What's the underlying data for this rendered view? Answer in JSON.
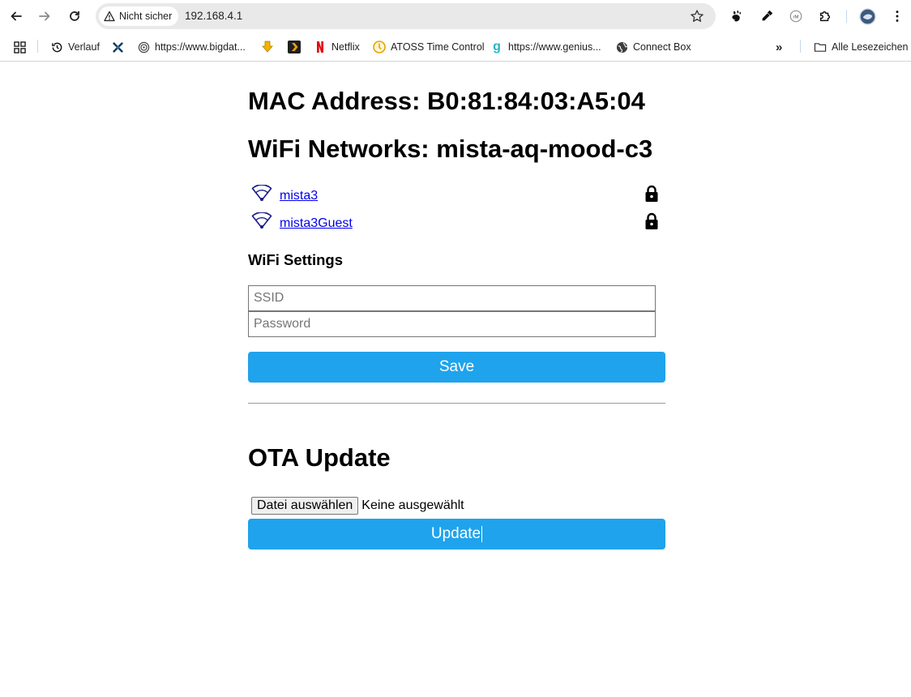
{
  "browser": {
    "security_label": "Nicht sicher",
    "url": "192.168.4.1",
    "bookmarks": [
      {
        "label": "",
        "icon": "apps-grid-icon"
      },
      {
        "label": "Verlauf",
        "icon": "history-icon"
      },
      {
        "label": "",
        "icon": "x-logo-icon"
      },
      {
        "label": "https://www.bigdat...",
        "icon": "globe-circle-icon"
      },
      {
        "label": "",
        "icon": "download-arrow-icon"
      },
      {
        "label": "",
        "icon": "plex-icon"
      },
      {
        "label": "Netflix",
        "icon": "netflix-icon"
      },
      {
        "label": "ATOSS Time Control",
        "icon": "atoss-icon"
      },
      {
        "label": "https://www.genius...",
        "icon": "genius-icon"
      },
      {
        "label": "Connect Box",
        "icon": "globe-icon"
      }
    ],
    "overflow": "»",
    "all_bookmarks_label": "Alle Lesezeichen"
  },
  "page": {
    "mac_heading": "MAC Address: B0:81:84:03:A5:04",
    "wifi_heading": "WiFi Networks: mista-aq-mood-c3",
    "networks": [
      {
        "ssid": "mista3",
        "secured": true
      },
      {
        "ssid": "mista3Guest",
        "secured": true
      }
    ],
    "settings_heading": "WiFi Settings",
    "ssid_placeholder": "SSID",
    "password_placeholder": "Password",
    "save_label": "Save",
    "ota_heading": "OTA Update",
    "file_button_label": "Datei auswählen",
    "file_status": "Keine ausgewählt",
    "update_label": "Update"
  },
  "colors": {
    "button": "#1fa3ec",
    "link": "#0000ee"
  }
}
